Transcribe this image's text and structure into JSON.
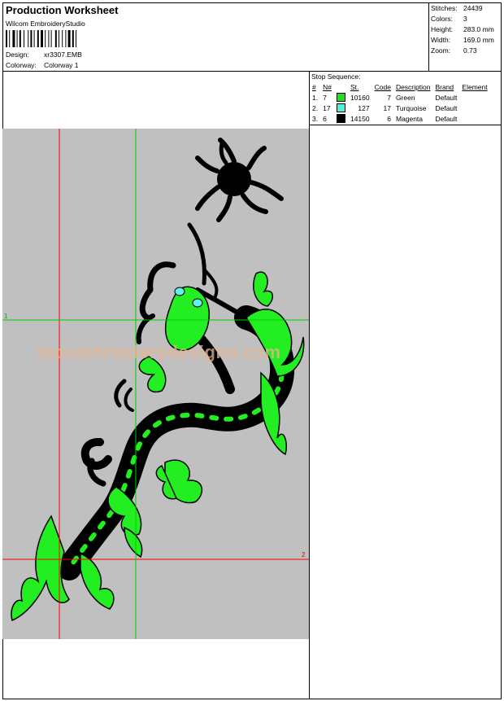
{
  "header": {
    "title": "Production Worksheet",
    "software": "Wilcom EmbroideryStudio",
    "design_label": "Design:",
    "design_value": "xr3307.EMB",
    "colorway_label": "Colorway:",
    "colorway_value": "Colorway 1"
  },
  "stats": [
    {
      "label": "Stitches:",
      "value": "24439"
    },
    {
      "label": "Colors:",
      "value": "3"
    },
    {
      "label": "Height:",
      "value": "283.0 mm"
    },
    {
      "label": "Width:",
      "value": "169.0 mm"
    },
    {
      "label": "Zoom:",
      "value": "0.73"
    }
  ],
  "stop_sequence": {
    "title": "Stop Sequence:",
    "columns": [
      "#",
      "N#",
      "",
      "St.",
      "Code",
      "Description",
      "Brand",
      "Element"
    ],
    "rows": [
      {
        "num": "1.",
        "n": "7",
        "color": "#22dd22",
        "st": "10160",
        "code": "7",
        "description": "Green",
        "brand": "Default",
        "element": ""
      },
      {
        "num": "2.",
        "n": "17",
        "color": "#55eedd",
        "st": "127",
        "code": "17",
        "description": "Turquoise",
        "brand": "Default",
        "element": ""
      },
      {
        "num": "3.",
        "n": "6",
        "color": "#000000",
        "st": "14150",
        "code": "6",
        "description": "Magenta",
        "brand": "Default",
        "element": ""
      }
    ]
  },
  "design": {
    "watermark": "topembroiderydesigns.com",
    "guide_labels": [
      "1",
      "2"
    ],
    "colors": {
      "background": "#c0c0c0",
      "green": "#22ee22",
      "black": "#000000",
      "turquoise": "#66eeee",
      "guide_red": "#ff0000",
      "guide_green": "#00cc00"
    }
  }
}
